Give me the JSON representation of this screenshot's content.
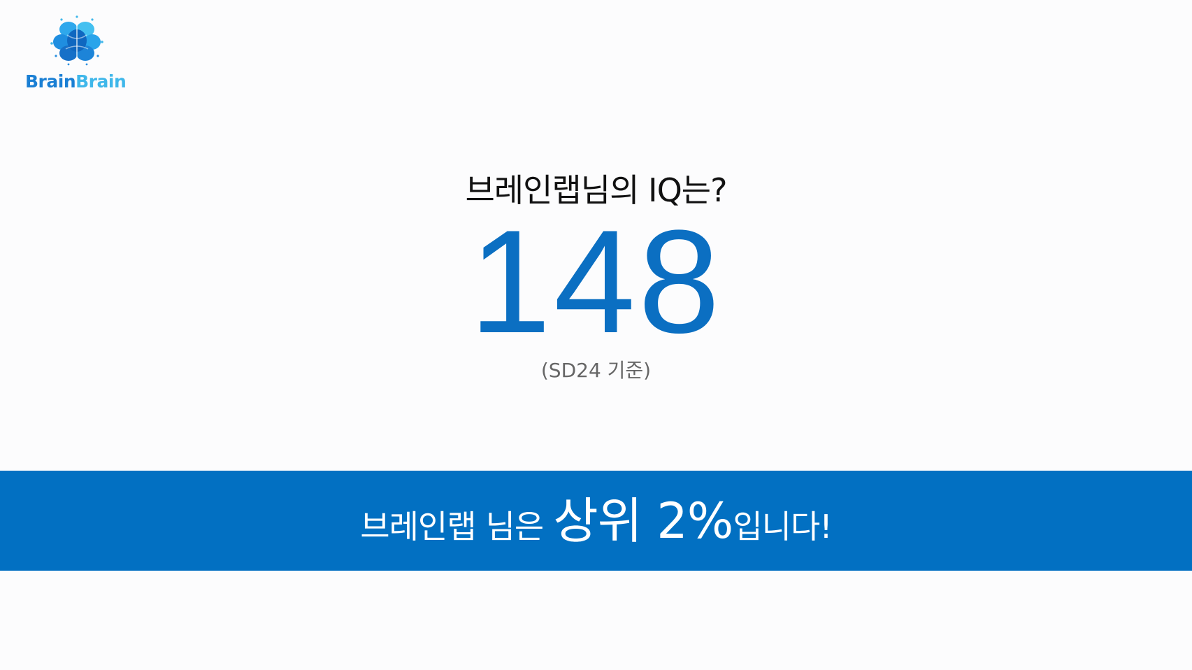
{
  "logo": {
    "word1": "Brain",
    "word2": "Brain",
    "icon": "brain-icon"
  },
  "result": {
    "question": "브레인랩님의 IQ는?",
    "score": "148",
    "note": "(SD24 기준)"
  },
  "banner": {
    "name": "브레인랩",
    "suffix": "님은",
    "rank": "상위 2%",
    "ending": "입니다!"
  },
  "colors": {
    "accent": "#0270c2",
    "score": "#0b6fc2",
    "logo_dark": "#1a7fd4",
    "logo_light": "#3fb7ea"
  }
}
